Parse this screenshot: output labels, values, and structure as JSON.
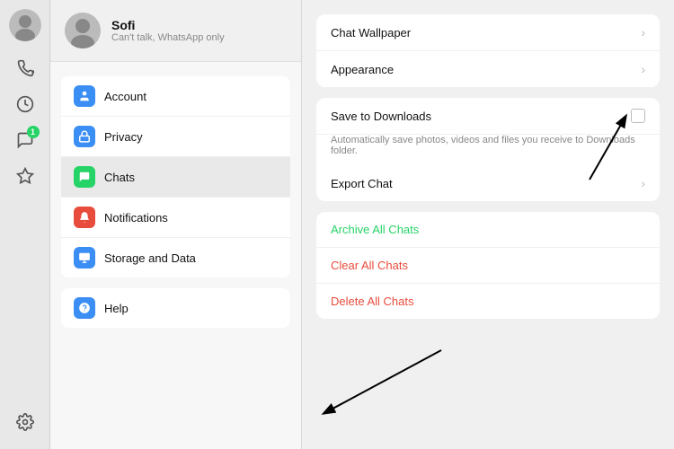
{
  "iconBar": {
    "badge": "1"
  },
  "user": {
    "name": "Sofi",
    "sub": "Can't talk, WhatsApp only"
  },
  "menu": {
    "items": [
      {
        "id": "account",
        "label": "Account",
        "color": "#3b8ef3",
        "icon": "👤"
      },
      {
        "id": "privacy",
        "label": "Privacy",
        "color": "#3b8ef3",
        "icon": "🔒"
      },
      {
        "id": "chats",
        "label": "Chats",
        "color": "#25d366",
        "icon": "💬",
        "active": true
      },
      {
        "id": "notifications",
        "label": "Notifications",
        "color": "#e74c3c",
        "icon": "🔔"
      },
      {
        "id": "storage",
        "label": "Storage and Data",
        "color": "#3b8ef3",
        "icon": "🗄️"
      }
    ],
    "help": {
      "label": "Help",
      "color": "#3b8ef3",
      "icon": "ℹ️"
    }
  },
  "rightPanel": {
    "groups": [
      {
        "rows": [
          {
            "label": "Chat Wallpaper",
            "type": "chevron"
          },
          {
            "label": "Appearance",
            "type": "chevron"
          }
        ]
      },
      {
        "rows": [
          {
            "label": "Save to Downloads",
            "type": "toggle",
            "sub": "Automatically save photos, videos and files you receive to Downloads folder."
          },
          {
            "label": "Export Chat",
            "type": "chevron"
          }
        ]
      }
    ],
    "dangerRows": [
      {
        "label": "Archive All Chats",
        "class": "danger-archive"
      },
      {
        "label": "Clear All Chats",
        "class": "danger-clear"
      },
      {
        "label": "Delete All Chats",
        "class": "danger-delete"
      }
    ]
  }
}
